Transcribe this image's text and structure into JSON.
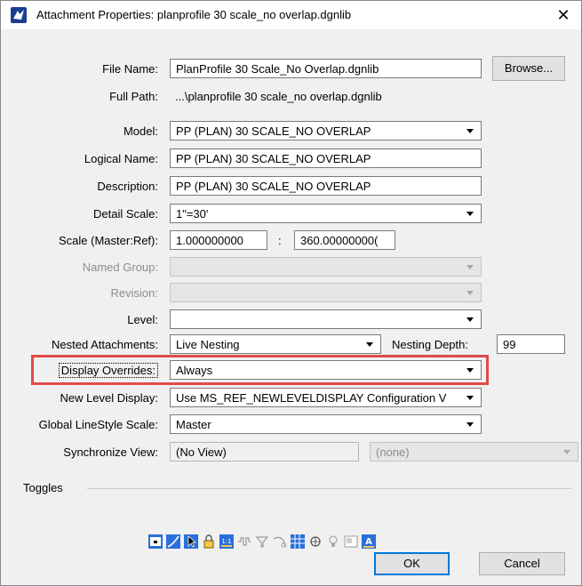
{
  "window": {
    "title": "Attachment Properties: planprofile 30 scale_no overlap.dgnlib",
    "close_glyph": "✕"
  },
  "fields": {
    "file_name": {
      "label": "File Name:",
      "value": "PlanProfile 30 Scale_No Overlap.dgnlib",
      "browse": "Browse..."
    },
    "full_path": {
      "label": "Full Path:",
      "value": "...\\planprofile 30 scale_no overlap.dgnlib"
    },
    "model": {
      "label": "Model:",
      "value": "PP (PLAN) 30 SCALE_NO OVERLAP"
    },
    "logical_name": {
      "label": "Logical Name:",
      "value": "PP (PLAN) 30 SCALE_NO OVERLAP"
    },
    "description": {
      "label": "Description:",
      "value": "PP (PLAN) 30 SCALE_NO OVERLAP"
    },
    "detail_scale": {
      "label": "Detail Scale:",
      "value": "1\"=30'"
    },
    "scale": {
      "label": "Scale (Master:Ref):",
      "master": "1.000000000",
      "sep": ":",
      "ref": "360.00000000("
    },
    "named_group": {
      "label": "Named Group:",
      "value": ""
    },
    "revision": {
      "label": "Revision:",
      "value": ""
    },
    "level": {
      "label": "Level:",
      "value": ""
    },
    "nested": {
      "label": "Nested Attachments:",
      "value": "Live Nesting",
      "depth_label": "Nesting Depth:",
      "depth": "99"
    },
    "display_overrides": {
      "label": "Display Overrides:",
      "value": "Always"
    },
    "new_level_display": {
      "label": "New Level Display:",
      "value": "Use MS_REF_NEWLEVELDISPLAY Configuration V"
    },
    "global_linestyle": {
      "label": "Global LineStyle Scale:",
      "value": "Master"
    },
    "sync_view": {
      "label": "Synchronize View:",
      "value": "(No View)",
      "value2": "(none)"
    }
  },
  "toggles": {
    "label": "Toggles",
    "icons": [
      "display-icon",
      "snap-icon",
      "locate-icon",
      "lock-icon",
      "true-scale-icon",
      "line-style-icon",
      "plot-icon",
      "clip-icon",
      "raster-icon",
      "treat-as-element-icon",
      "light-icon",
      "properties-icon",
      "annotation-scale-icon"
    ]
  },
  "buttons": {
    "ok": "OK",
    "cancel": "Cancel"
  },
  "colors": {
    "highlight": "#e04a4a",
    "accent": "#0078d7"
  }
}
